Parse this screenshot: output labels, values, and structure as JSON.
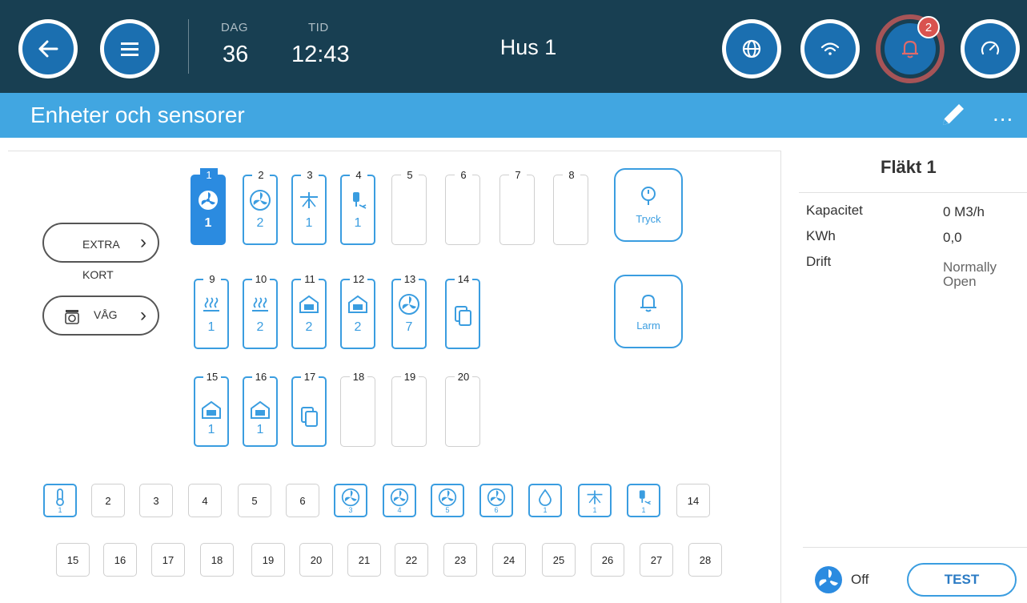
{
  "topbar": {
    "day_label": "DAG",
    "day_value": "36",
    "time_label": "TID",
    "time_value": "12:43",
    "house_title": "Hus 1",
    "alarm_count": "2"
  },
  "header": {
    "title": "Enheter och sensorer",
    "more": "..."
  },
  "left_buttons": {
    "extra_card": "EXTRA KORT",
    "scale": "VÅG"
  },
  "device_slots": [
    {
      "num": "1",
      "icon": "fan-icon",
      "count": "1",
      "selected": true
    },
    {
      "num": "2",
      "icon": "fan-icon",
      "count": "2"
    },
    {
      "num": "3",
      "icon": "sprinkler-icon",
      "count": "1"
    },
    {
      "num": "4",
      "icon": "water-valve-icon",
      "count": "1"
    },
    {
      "num": "5",
      "icon": "",
      "count": ""
    },
    {
      "num": "6",
      "icon": "",
      "count": ""
    },
    {
      "num": "7",
      "icon": "",
      "count": ""
    },
    {
      "num": "8",
      "icon": "",
      "count": ""
    },
    {
      "num": "9",
      "icon": "heater-icon",
      "count": "1"
    },
    {
      "num": "10",
      "icon": "heater-icon",
      "count": "2"
    },
    {
      "num": "11",
      "icon": "curtain-open-icon",
      "count": "2"
    },
    {
      "num": "12",
      "icon": "curtain-close-icon",
      "count": "2"
    },
    {
      "num": "13",
      "icon": "fan-icon",
      "count": "7"
    },
    {
      "num": "14",
      "icon": "copy-icon",
      "count": ""
    },
    {
      "num": "15",
      "icon": "curtain-open-icon",
      "count": "1"
    },
    {
      "num": "16",
      "icon": "curtain-close-icon",
      "count": "1"
    },
    {
      "num": "17",
      "icon": "copy-icon",
      "count": ""
    },
    {
      "num": "18",
      "icon": "",
      "count": ""
    },
    {
      "num": "19",
      "icon": "",
      "count": ""
    },
    {
      "num": "20",
      "icon": "",
      "count": ""
    }
  ],
  "side_buttons": {
    "pressure": "Tryck",
    "alarm": "Larm"
  },
  "sensors_row1": [
    {
      "label": "",
      "icon": "thermometer-icon",
      "count": "1"
    },
    {
      "label": "2"
    },
    {
      "label": "3"
    },
    {
      "label": "4"
    },
    {
      "label": "5"
    },
    {
      "label": "6"
    },
    {
      "label": "",
      "icon": "fan-icon",
      "count": "3"
    },
    {
      "label": "",
      "icon": "fan-icon",
      "count": "4"
    },
    {
      "label": "",
      "icon": "fan-icon",
      "count": "5"
    },
    {
      "label": "",
      "icon": "fan-icon",
      "count": "6"
    },
    {
      "label": "",
      "icon": "water-drop-icon",
      "count": "1"
    },
    {
      "label": "",
      "icon": "sprinkler-icon",
      "count": "1"
    },
    {
      "label": "",
      "icon": "water-valve-icon",
      "count": "1"
    },
    {
      "label": "14"
    }
  ],
  "sensors_row2": [
    "15",
    "16",
    "17",
    "18",
    "19",
    "20",
    "21",
    "22",
    "23",
    "24",
    "25",
    "26",
    "27",
    "28"
  ],
  "detail": {
    "title": "Fläkt 1",
    "capacity_label": "Kapacitet",
    "capacity_value": "0 M3/h",
    "kwh_label": "KWh",
    "kwh_value": "0,0",
    "mode_label": "Drift",
    "mode_value_1": "Normally",
    "mode_value_2": "Open",
    "status": "Off",
    "test_label": "TEST"
  },
  "colors": {
    "topbar": "#183f52",
    "header": "#41a6e1",
    "accent": "#3a9de0",
    "button_fill": "#1b6fb0",
    "alarm_ring": "#a65457",
    "badge": "#d9534f"
  }
}
